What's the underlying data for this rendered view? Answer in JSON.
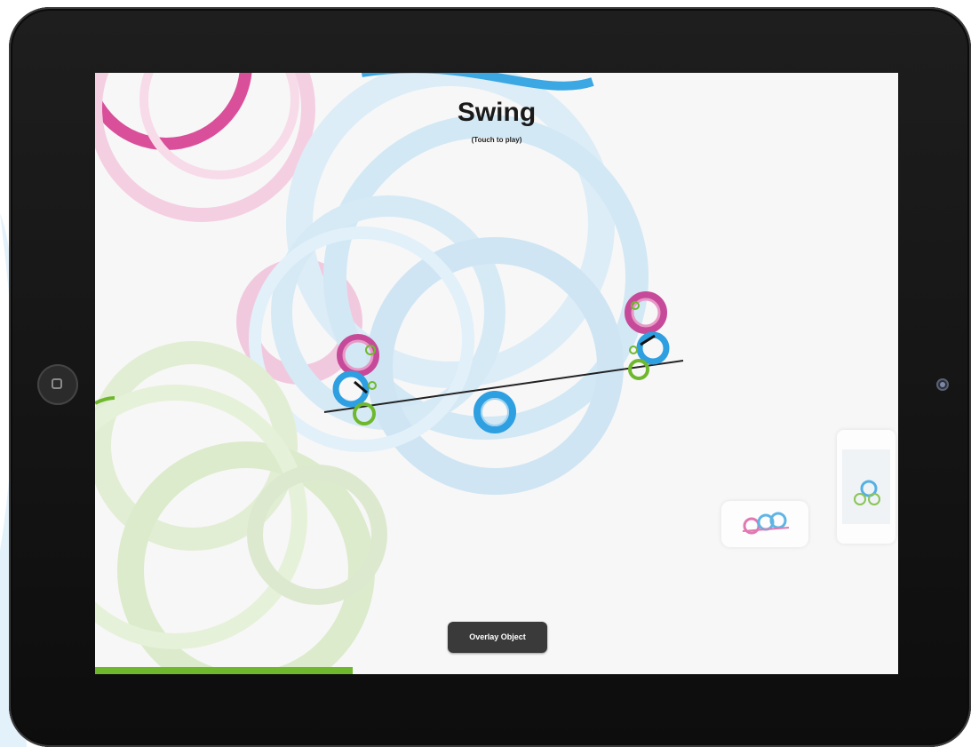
{
  "app": {
    "title": "Swing",
    "subtitle": "(Touch to play)",
    "overlay_button_label": "Overlay Object"
  },
  "icons": {
    "home": "home-button-square-icon",
    "camera": "front-camera-icon"
  },
  "colors": {
    "pink": "#d94f9a",
    "blue": "#2e9fe0",
    "green": "#6fb82e",
    "light_blue": "#cfe6f4",
    "light_green": "#dfeccf",
    "light_pink": "#f4cfe2",
    "button_bg": "#3a3a3a"
  }
}
